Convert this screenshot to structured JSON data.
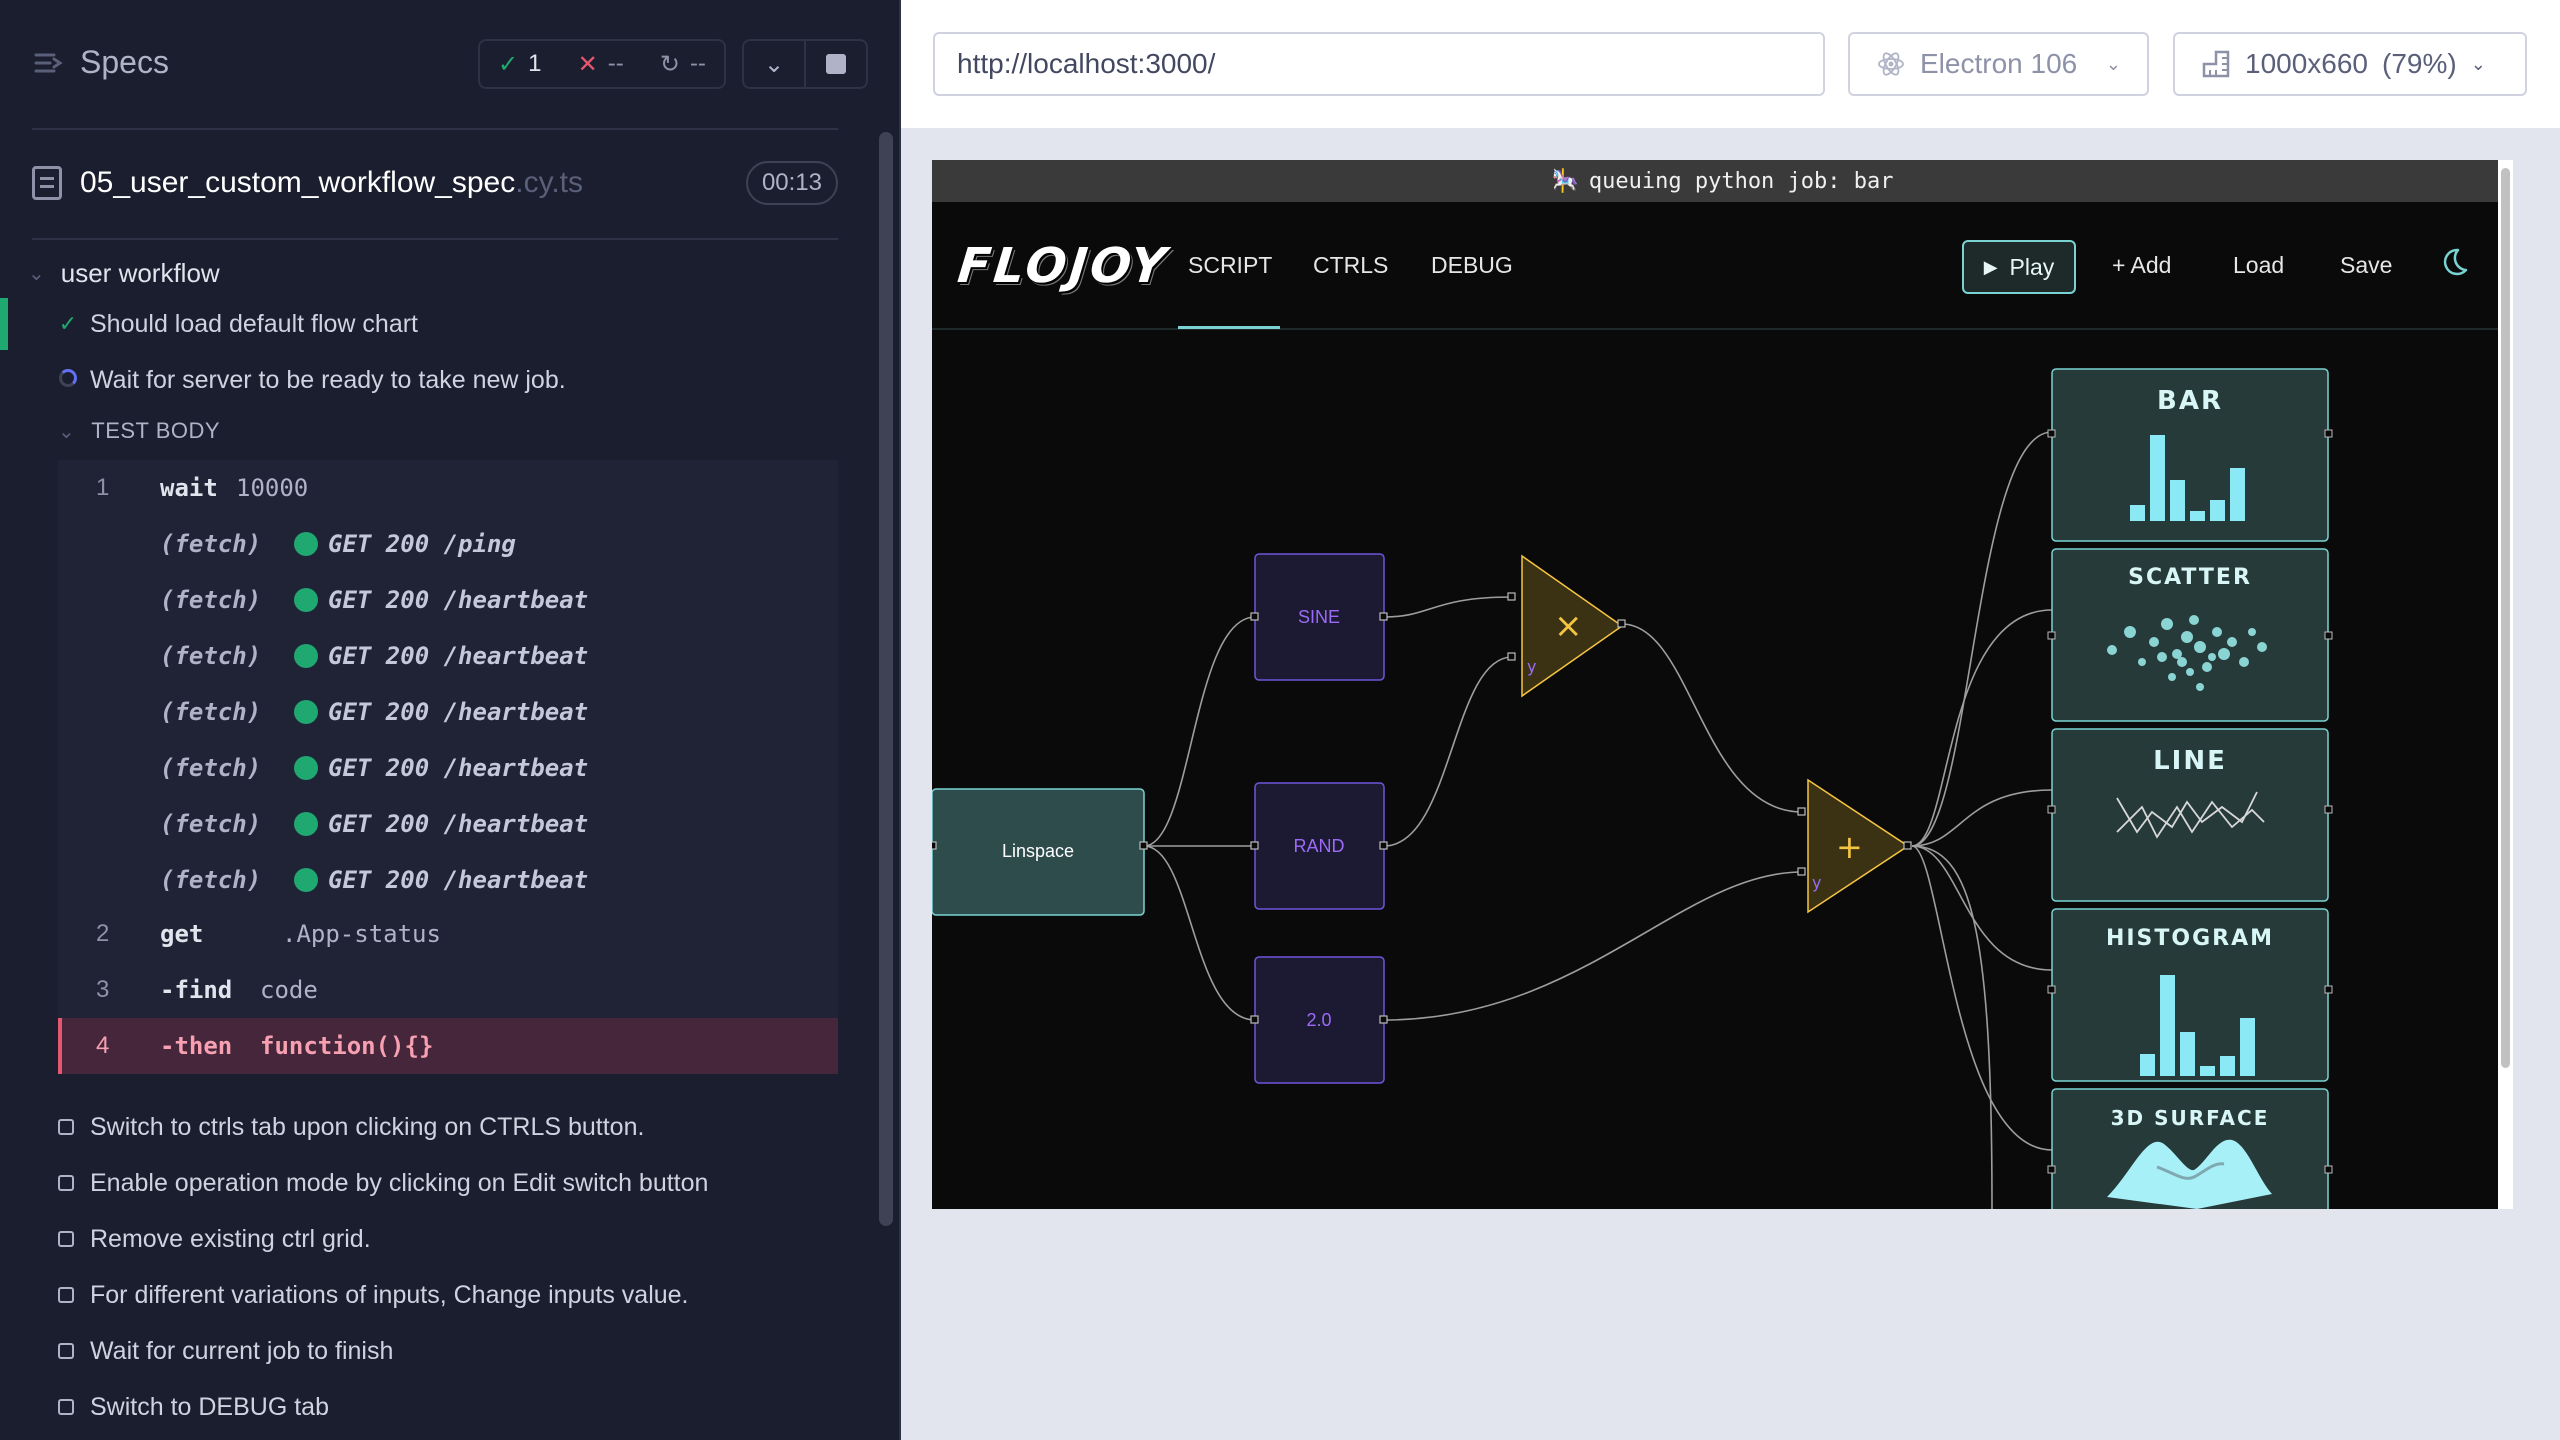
{
  "reporter": {
    "specs_label": "Specs",
    "stats": {
      "passed": "1",
      "failed": "--",
      "pending": "--"
    },
    "file": {
      "name": "05_user_custom_workflow_spec",
      "ext": ".cy.ts",
      "duration": "00:13"
    },
    "suite": "user workflow",
    "tests": [
      {
        "label": "Should load default flow chart",
        "state": "passed"
      },
      {
        "label": "Wait for server to be ready to take new job.",
        "state": "running"
      }
    ],
    "test_body_label": "TEST BODY",
    "commands": [
      {
        "num": "1",
        "name": "wait",
        "msg": "10000"
      },
      {
        "num": "",
        "name": "(fetch)",
        "msg": "GET 200 /ping"
      },
      {
        "num": "",
        "name": "(fetch)",
        "msg": "GET 200 /heartbeat"
      },
      {
        "num": "",
        "name": "(fetch)",
        "msg": "GET 200 /heartbeat"
      },
      {
        "num": "",
        "name": "(fetch)",
        "msg": "GET 200 /heartbeat"
      },
      {
        "num": "",
        "name": "(fetch)",
        "msg": "GET 200 /heartbeat"
      },
      {
        "num": "",
        "name": "(fetch)",
        "msg": "GET 200 /heartbeat"
      },
      {
        "num": "",
        "name": "(fetch)",
        "msg": "GET 200 /heartbeat"
      },
      {
        "num": "2",
        "name": "get",
        "msg": ".App-status"
      },
      {
        "num": "3",
        "name": "-find",
        "msg": "code"
      },
      {
        "num": "4",
        "name": "-then",
        "msg": "function(){}"
      }
    ],
    "pending_tests": [
      "Switch to ctrls tab upon clicking on CTRLS button.",
      "Enable operation mode by clicking on Edit switch button",
      "Remove existing ctrl grid.",
      "For different variations of inputs, Change inputs value.",
      "Wait for current job to finish",
      "Switch to DEBUG tab"
    ]
  },
  "browser": {
    "url": "http://localhost:3000/",
    "browser_name": "Electron 106",
    "viewport": "1000x660",
    "zoom": "(79%)"
  },
  "app": {
    "status_message": "queuing python job: bar",
    "logo": "FLOJOY",
    "tabs": [
      "SCRIPT",
      "CTRLS",
      "DEBUG"
    ],
    "active_tab": "SCRIPT",
    "actions": {
      "play": "Play",
      "add": "+ Add",
      "load": "Load",
      "save": "Save"
    },
    "nodes": {
      "linspace": "Linspace",
      "sine": "SINE",
      "rand": "RAND",
      "constant": "2.0",
      "multiply_symbol": "×",
      "add_symbol": "+",
      "y_port": "y"
    },
    "visualizers": [
      "BAR",
      "SCATTER",
      "LINE",
      "HISTOGRAM",
      "3D SURFACE"
    ]
  },
  "colors": {
    "pass": "#1fa971",
    "fail": "#e45770",
    "accent_teal": "#79d3d3",
    "node_purple": "#9b6bf5",
    "node_gold": "#f5c542"
  }
}
